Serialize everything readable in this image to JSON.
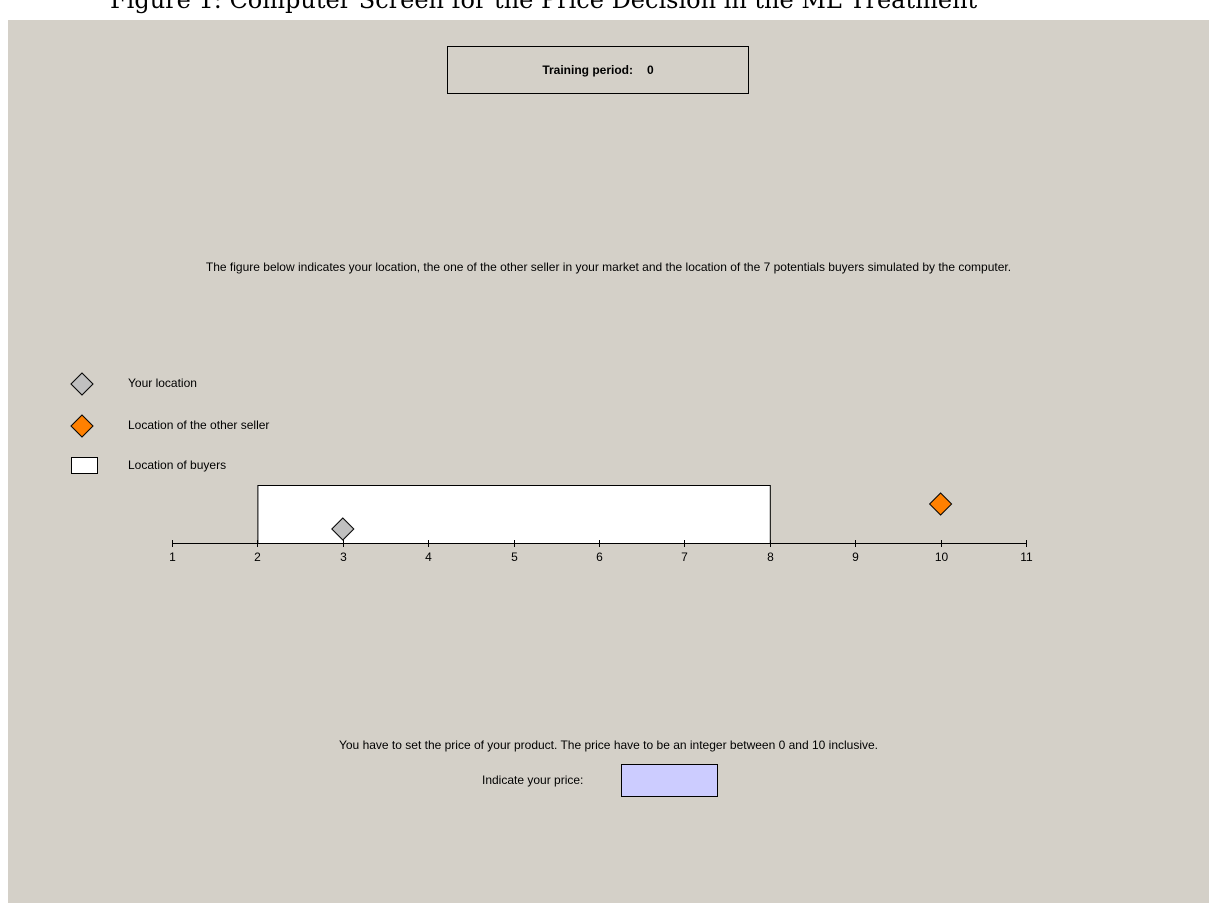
{
  "caption": "Figure 1: Computer Screen for the Price Decision in the ML Treatment",
  "header": {
    "period_label": "Training period:",
    "period_value": "0"
  },
  "instruction": "The figure below indicates your location, the one of the other seller in your market and the location of the 7 potentials buyers simulated by the computer.",
  "legend": {
    "your_location": "Your location",
    "other_seller": "Location of the other seller",
    "buyers": "Location of buyers"
  },
  "colors": {
    "background": "#d4d0c8",
    "your_marker": "#c0c0c0",
    "other_marker": "#ff8000",
    "buyers_fill": "#ffffff",
    "price_input": "#ccccff"
  },
  "market_line": {
    "ticks": [
      "1",
      "2",
      "3",
      "4",
      "5",
      "6",
      "7",
      "8",
      "9",
      "10",
      "11"
    ],
    "axis_min": 1,
    "axis_max": 11,
    "buyers_range": [
      2,
      8
    ],
    "your_location": 3,
    "other_seller_location": 10
  },
  "price": {
    "note": "You have to set the price of your product. The price have to be an integer between 0 and 10 inclusive.",
    "label": "Indicate your price:",
    "value": ""
  }
}
